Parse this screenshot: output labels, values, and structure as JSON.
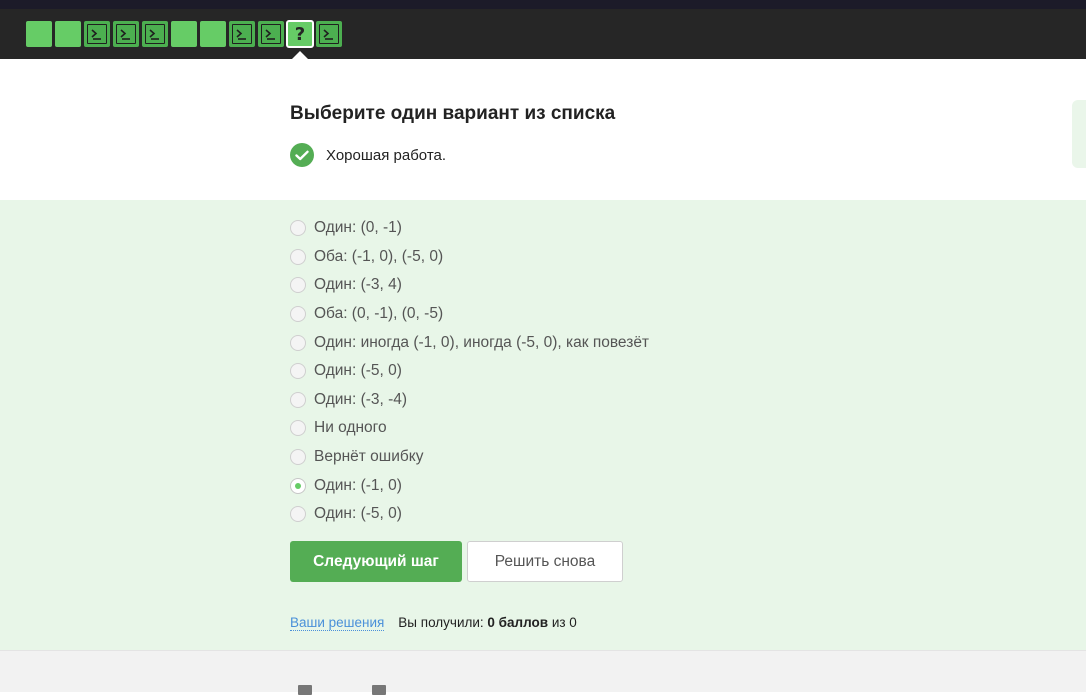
{
  "steps": [
    {
      "type": "theory",
      "state": "passed"
    },
    {
      "type": "theory",
      "state": "passed"
    },
    {
      "type": "code",
      "state": "passed",
      "icon": "terminal-icon"
    },
    {
      "type": "code",
      "state": "passed",
      "icon": "terminal-icon"
    },
    {
      "type": "code",
      "state": "passed",
      "icon": "terminal-icon"
    },
    {
      "type": "theory",
      "state": "passed"
    },
    {
      "type": "theory",
      "state": "passed"
    },
    {
      "type": "code",
      "state": "passed",
      "icon": "terminal-icon"
    },
    {
      "type": "code",
      "state": "passed",
      "icon": "terminal-icon"
    },
    {
      "type": "quiz",
      "state": "current",
      "icon": "question-icon",
      "glyph": "?"
    },
    {
      "type": "code",
      "state": "passed",
      "icon": "terminal-icon"
    }
  ],
  "question": {
    "title": "Выберите один вариант из списка",
    "feedback": "Хорошая работа."
  },
  "options": [
    {
      "label": "Один: (0, -1)",
      "checked": false
    },
    {
      "label": "Оба: (-1, 0), (-5, 0)",
      "checked": false
    },
    {
      "label": "Один: (-3, 4)",
      "checked": false
    },
    {
      "label": "Оба: (0, -1), (0, -5)",
      "checked": false
    },
    {
      "label": "Один: иногда (-1, 0), иногда (-5, 0), как повезёт",
      "checked": false
    },
    {
      "label": "Один: (-5, 0)",
      "checked": false
    },
    {
      "label": "Один: (-3, -4)",
      "checked": false
    },
    {
      "label": "Ни одного",
      "checked": false
    },
    {
      "label": "Вернёт ошибку",
      "checked": false
    },
    {
      "label": "Один: (-1, 0)",
      "checked": true
    },
    {
      "label": "Один: (-5, 0)",
      "checked": false
    }
  ],
  "actions": {
    "next_label": "Следующий шаг",
    "retry_label": "Решить снова"
  },
  "footer": {
    "solutions_link": "Ваши решения",
    "score_prefix": "Вы получили:",
    "score_value": "0 баллов",
    "score_suffix": "из 0"
  },
  "colors": {
    "accent": "#54ad54",
    "step_passed": "#66cc66",
    "answer_bg": "#e8f6e8",
    "stepbar_bg": "#262626"
  }
}
